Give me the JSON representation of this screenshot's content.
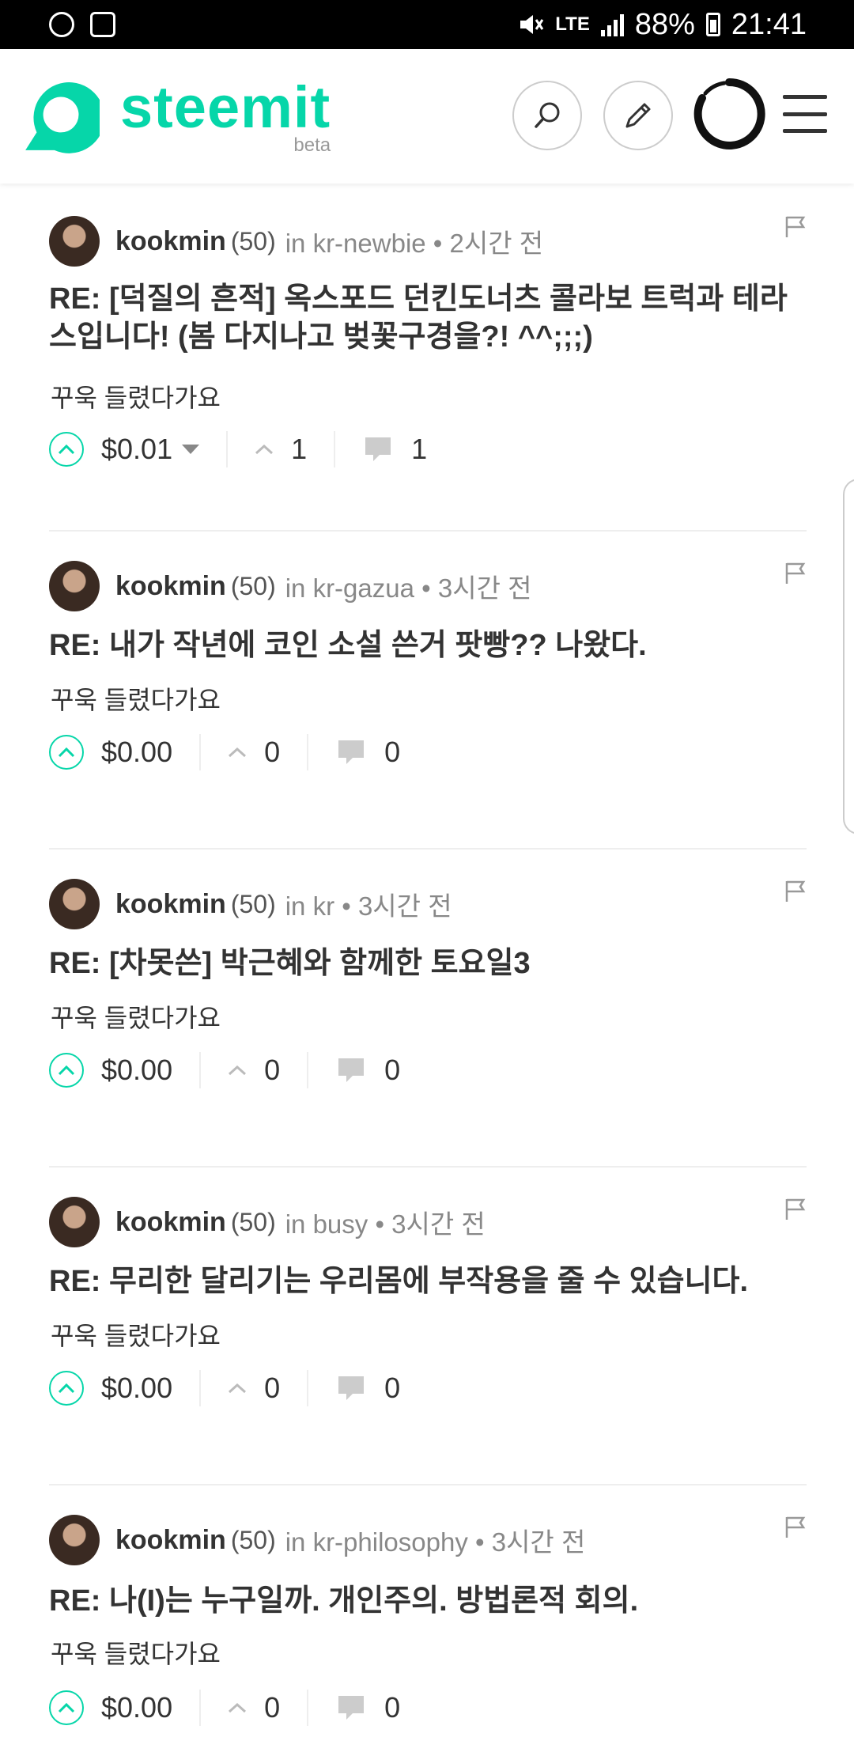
{
  "status_bar": {
    "lte": "LTE",
    "battery": "88%",
    "time": "21:41"
  },
  "header": {
    "brand": "steemit",
    "beta": "beta"
  },
  "colors": {
    "accent": "#06d6a9",
    "text": "#333333",
    "muted": "#888888"
  },
  "posts": [
    {
      "author": "kookmin",
      "reputation": "(50)",
      "meta": "in kr-newbie • 2시간 전",
      "title": "RE: [덕질의 흔적] 옥스포드 던킨도너츠 콜라보 트럭과 테라스입니다! (봄 다지나고 벚꽃구경을?! ^^;;;)",
      "body": "꾸욱 들렸다가요",
      "payout": "$0.01",
      "votes": "1",
      "comments": "1"
    },
    {
      "author": "kookmin",
      "reputation": "(50)",
      "meta": "in kr-gazua • 3시간 전",
      "title": "RE: 내가 작년에 코인 소설 쓴거 팟빵?? 나왔다.",
      "body": "꾸욱 들렸다가요",
      "payout": "$0.00",
      "votes": "0",
      "comments": "0"
    },
    {
      "author": "kookmin",
      "reputation": "(50)",
      "meta": "in kr • 3시간 전",
      "title": "RE: [차못쓴] 박근혜와 함께한 토요일3",
      "body": "꾸욱 들렸다가요",
      "payout": "$0.00",
      "votes": "0",
      "comments": "0"
    },
    {
      "author": "kookmin",
      "reputation": "(50)",
      "meta": "in busy • 3시간 전",
      "title": "RE: 무리한 달리기는 우리몸에 부작용을 줄 수 있습니다.",
      "body": "꾸욱 들렸다가요",
      "payout": "$0.00",
      "votes": "0",
      "comments": "0"
    },
    {
      "author": "kookmin",
      "reputation": "(50)",
      "meta": "in kr-philosophy • 3시간 전",
      "title": "RE: 나(I)는 누구일까. 개인주의. 방법론적 회의.",
      "body": "꾸욱 들렸다가요",
      "payout": "$0.00",
      "votes": "0",
      "comments": "0"
    }
  ]
}
